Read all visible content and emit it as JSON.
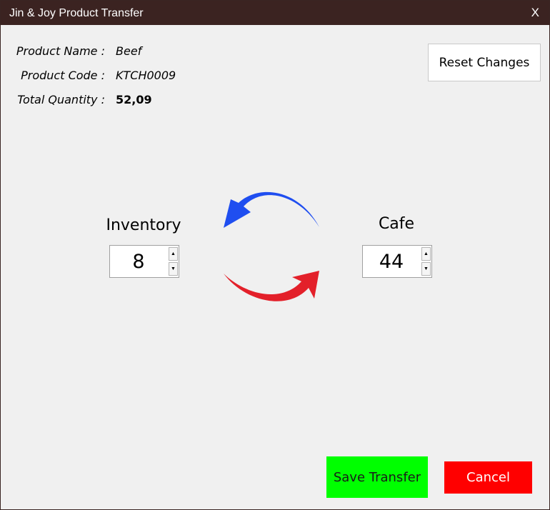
{
  "window": {
    "title": "Jin & Joy Product Transfer",
    "close_label": "X"
  },
  "product": {
    "name_label": "Product Name :",
    "name_value": "Beef",
    "code_label": "Product Code :",
    "code_value": "KTCH0009",
    "qty_label": "Total Quantity :",
    "qty_value": "52,09"
  },
  "reset_label": "Reset Changes",
  "locations": {
    "left": {
      "label": "Inventory",
      "value": "8"
    },
    "right": {
      "label": "Cafe",
      "value": "44"
    }
  },
  "spin_up_glyph": "▲",
  "spin_down_glyph": "▼",
  "arrows": {
    "top_color": "#1f4ef0",
    "bottom_color": "#e3202a"
  },
  "buttons": {
    "save_label": "Save Transfer",
    "cancel_label": "Cancel",
    "save_color": "#00ff00",
    "cancel_color": "#ff0000"
  }
}
